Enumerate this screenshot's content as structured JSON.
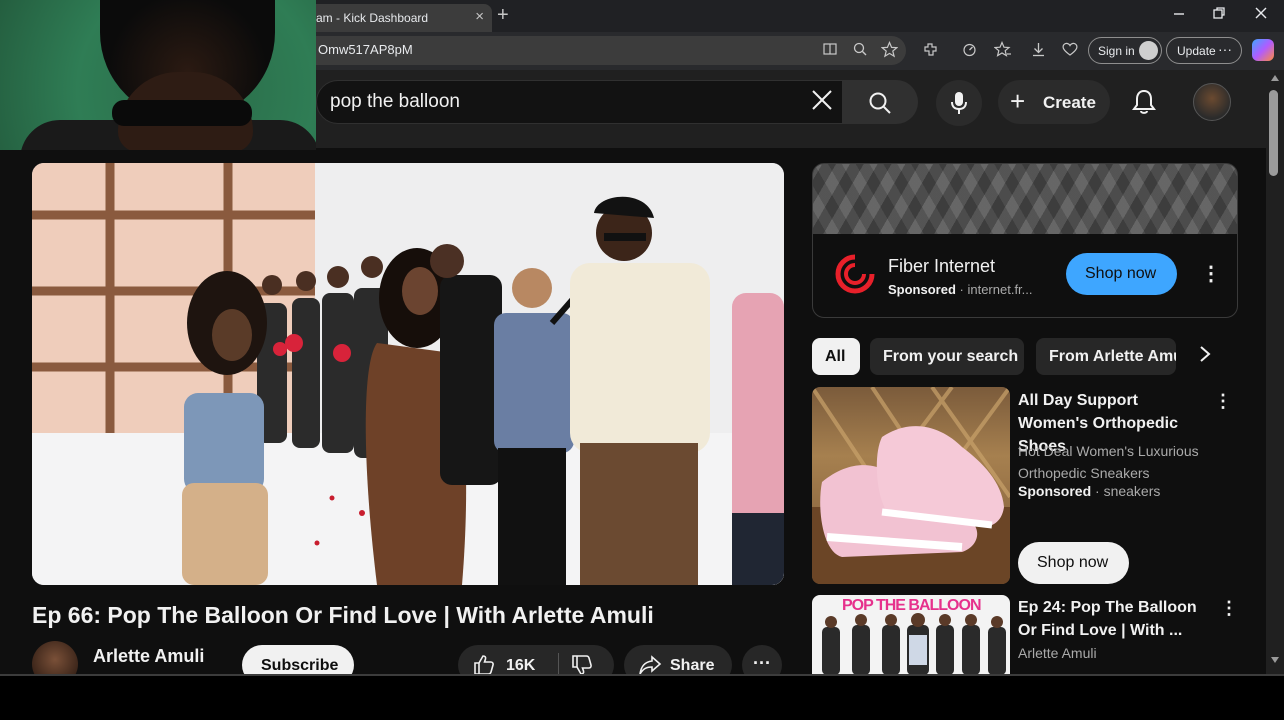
{
  "browser": {
    "tab_title": "am - Kick Dashboard",
    "tab_close": "×",
    "new_tab": "+",
    "url": "Omw517AP8pM",
    "sign_in": "Sign in",
    "update": "Update",
    "update_dots": "···"
  },
  "youtube": {
    "search_query": "pop the balloon",
    "create_label": "Create"
  },
  "video": {
    "title": "Ep 66: Pop The Balloon Or Find Love | With Arlette Amuli",
    "channel": "Arlette Amuli",
    "subscribe": "Subscribe",
    "likes": "16K",
    "share": "Share"
  },
  "ad": {
    "title": "Fiber Internet",
    "sponsored": "Sponsored",
    "domain": "internet.fr...",
    "cta": "Shop now"
  },
  "chips": [
    "All",
    "From your search",
    "From Arlette Amuli"
  ],
  "recommendations": [
    {
      "title": "All Day Support Women's Orthopedic Shoes",
      "desc": "Hot Deal Women's Luxurious Orthopedic Sneakers",
      "sponsored": "Sponsored",
      "tag": "sneakers",
      "cta": "Shop now"
    },
    {
      "title": "Ep 24: Pop The Balloon Or Find Love | With ...",
      "channel": "Arlette Amuli",
      "thumb_text": "POP THE BALLOON"
    }
  ],
  "colors": {
    "accent_blue": "#3ea6ff",
    "fiber_red": "#e8202a",
    "brand_pink": "#e6308c"
  }
}
